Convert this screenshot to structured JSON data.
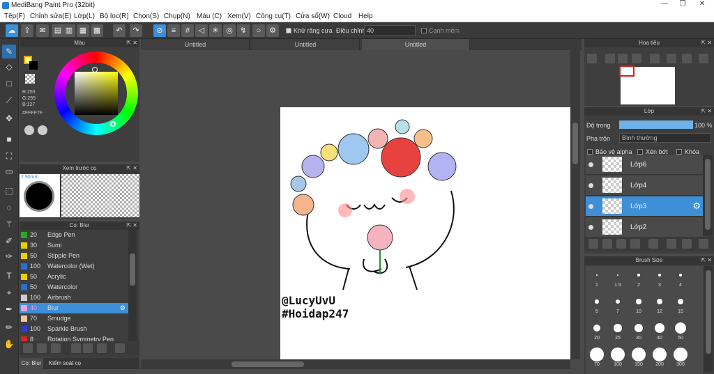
{
  "window": {
    "title": "MediBang Paint Pro (32bit)",
    "min": "—",
    "max": "❐",
    "close": "✕"
  },
  "menu": [
    "Tệp(F)",
    "Chỉnh sửa(E)",
    "Lớp(L)",
    "Bộ lọc(R)",
    "Chọn(S)",
    "Chụp(N)",
    "Màu (C)",
    "Xem(V)",
    "Công cụ(T)",
    "Cửa sổ(W)",
    "Cloud",
    "Help"
  ],
  "toolbar": {
    "antialias_label": "Khử răng cưa",
    "adjust_label": "Điều chỉnh",
    "adjust_value": "40",
    "edge_label": "Cạnh mềm"
  },
  "tabs": [
    "Untitled",
    "Untitled",
    "Untitled"
  ],
  "color_panel": {
    "title": "Màu",
    "r": "R:255",
    "g": "G:255",
    "b": "B:127",
    "hex": "#FFFF7F",
    "fg": "#FFFF7F",
    "bg": "#E8A000"
  },
  "brush_preview": {
    "title": "Xem trước cọ",
    "size": "2.90mm"
  },
  "brush_panel": {
    "title": "Cọ: Blur",
    "items": [
      {
        "n": "20",
        "name": "Edge Pen",
        "color": "#22aa22"
      },
      {
        "n": "30",
        "name": "Sumi",
        "color": "#e8d000"
      },
      {
        "n": "50",
        "name": "Stipple Pen",
        "color": "#e8d000"
      },
      {
        "n": "100",
        "name": "Watercolor (Wet)",
        "color": "#2a6fd6"
      },
      {
        "n": "50",
        "name": "Acrylic",
        "color": "#e8d000"
      },
      {
        "n": "50",
        "name": "Watercolor",
        "color": "#2a6fd6"
      },
      {
        "n": "100",
        "name": "Airbrush",
        "color": "#cccccc"
      },
      {
        "n": "40",
        "name": "Blur",
        "color": "#f0a0d8"
      },
      {
        "n": "70",
        "name": "Smudge",
        "color": "#f0c8a0"
      },
      {
        "n": "100",
        "name": "Sparkle Brush",
        "color": "#2a3ad6"
      },
      {
        "n": "8",
        "name": "Rotation Symmetry Pen",
        "color": "#dd2222"
      }
    ],
    "selected_index": 7
  },
  "bottom_tabs": [
    "Cọ: Blur",
    "Kiểm soát cọ"
  ],
  "navigator": {
    "title": "Hoa tiêu"
  },
  "layers": {
    "title": "Lớp",
    "opacity_label": "Độ trong",
    "opacity_value": "100 %",
    "opacity_fraction": 1.0,
    "blend_label": "Pha trộn",
    "blend_value": "Bình thường",
    "protect_alpha": "Bảo vệ alpha",
    "clipping": "Xén bớt",
    "lock": "Khóa",
    "rows": [
      {
        "name": "Lớp6"
      },
      {
        "name": "Lớp4"
      },
      {
        "name": "Lớp3"
      },
      {
        "name": "Lớp2"
      }
    ],
    "selected_index": 2
  },
  "brush_size": {
    "title": "Brush Size",
    "sizes": [
      "1",
      "1.5",
      "2",
      "3",
      "4",
      "5",
      "7",
      "10",
      "12",
      "15",
      "20",
      "25",
      "30",
      "40",
      "50",
      "70",
      "100",
      "150",
      "200",
      "300"
    ]
  },
  "canvas_text": {
    "line1": "@LucyUvU",
    "line2": "#Hoidap247"
  }
}
